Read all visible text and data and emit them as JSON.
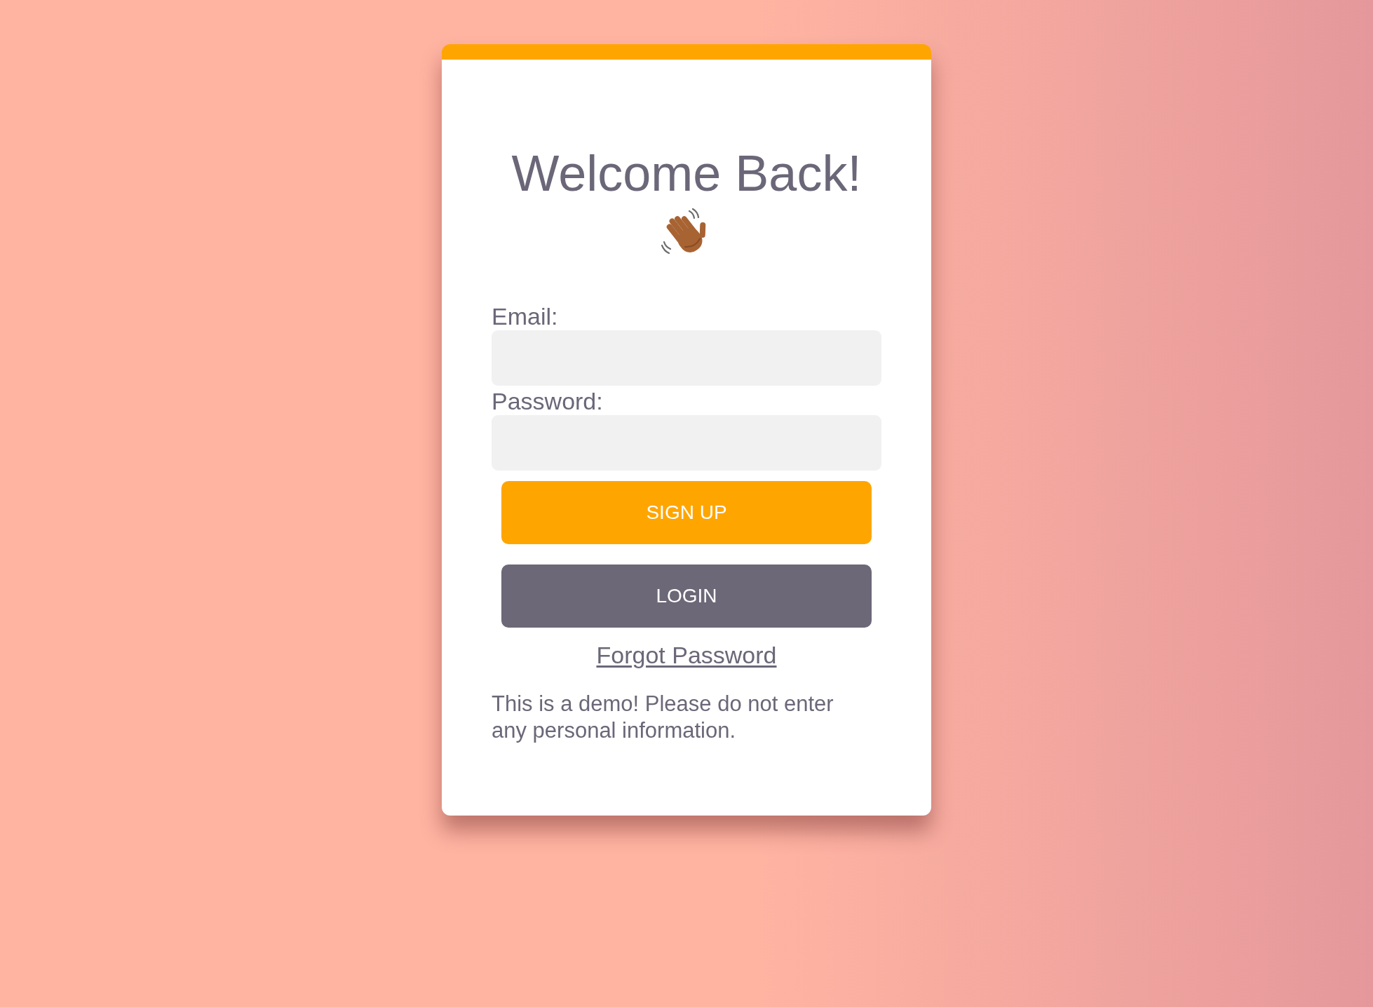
{
  "card": {
    "heading": "Welcome Back!",
    "fields": [
      {
        "label": "Email:"
      },
      {
        "label": "Password:"
      }
    ],
    "buttons": [
      {
        "label": "SIGN UP",
        "kind": "signup"
      },
      {
        "label": "LOGIN",
        "kind": "login"
      }
    ],
    "link": "Forgot Password",
    "notice": "This is a demo! Please do not enter any personal information."
  }
}
